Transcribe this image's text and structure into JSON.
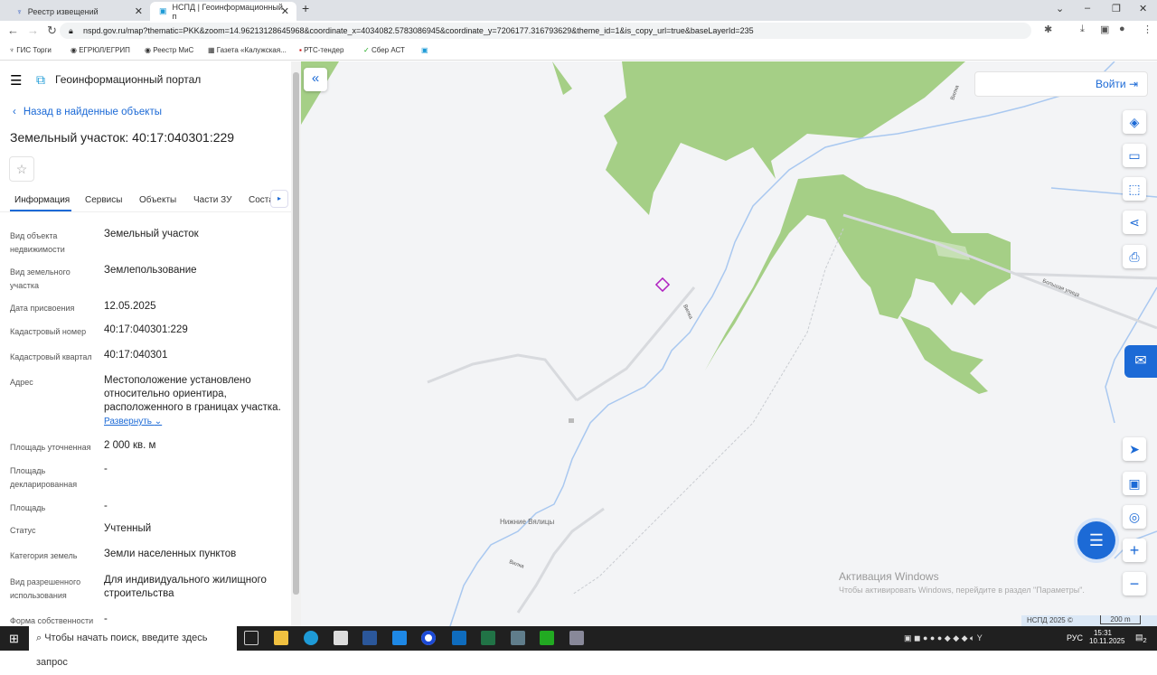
{
  "browser": {
    "tabs": [
      {
        "title": "Реестр извещений"
      },
      {
        "title": "НСПД | Геоинформационный п"
      }
    ],
    "url": "nspd.gov.ru/map?thematic=PKK&zoom=14.96213128645968&coordinate_x=4034082.5783086945&coordinate_y=7206177.316793629&theme_id=1&is_copy_url=true&baseLayerId=235",
    "bookmarks": [
      "ГИС Торги",
      "ЕГРЮЛ/ЕГРИП",
      "Реестр МиС",
      "Газета «Калужская...",
      "РТС-тендер",
      "Сбер АСТ"
    ]
  },
  "portal": {
    "title": "Геоинформационный портал",
    "back": "Назад в найденные объекты",
    "object_title": "Земельный участок: 40:17:040301:229",
    "tabs": [
      "Информация",
      "Сервисы",
      "Объекты",
      "Части ЗУ",
      "Соста"
    ],
    "fields": [
      {
        "label": "Вид объекта недвижимости",
        "value": "Земельный участок"
      },
      {
        "label": "Вид земельного участка",
        "value": "Землепользование"
      },
      {
        "label": "Дата присвоения",
        "value": "12.05.2025"
      },
      {
        "label": "Кадастровый номер",
        "value": "40:17:040301:229"
      },
      {
        "label": "Кадастровый квартал",
        "value": "40:17:040301"
      },
      {
        "label": "Адрес",
        "value": "Местоположение установлено относительно ориентира, расположенного в границах участка."
      },
      {
        "label": "Площадь уточненная",
        "value": "2 000 кв. м"
      },
      {
        "label": "Площадь декларированная",
        "value": "-"
      },
      {
        "label": "Площадь",
        "value": "-"
      },
      {
        "label": "Статус",
        "value": "Учтенный"
      },
      {
        "label": "Категория земель",
        "value": "Земли населенных пунктов"
      },
      {
        "label": "Вид разрешенного использования",
        "value": "Для индивидуального жилищного строительства"
      },
      {
        "label": "Форма собственности",
        "value": "-"
      }
    ],
    "expand": "Развернуть"
  },
  "map": {
    "login": "Войти",
    "labels": {
      "village": "Нижние Вялицы",
      "river1": "Вилка",
      "river2": "Вилка",
      "river3": "Вилка",
      "street": "Большая улица"
    },
    "copyright": "НСПД 2025 ©",
    "scale": "200 m",
    "watermark": {
      "title": "Активация Windows",
      "text": "Чтобы активировать Windows, перейдите в раздел \"Параметры\"."
    },
    "colors": {
      "forest": "#a5cf86",
      "river": "#a9c8f0",
      "bg": "#f3f4f6",
      "accent": "#1c6ad6"
    }
  },
  "taskbar": {
    "search": "Чтобы начать поиск, введите здесь запрос",
    "lang": "РУС",
    "time": "15:31",
    "date": "10.11.2025",
    "notif": "2"
  }
}
